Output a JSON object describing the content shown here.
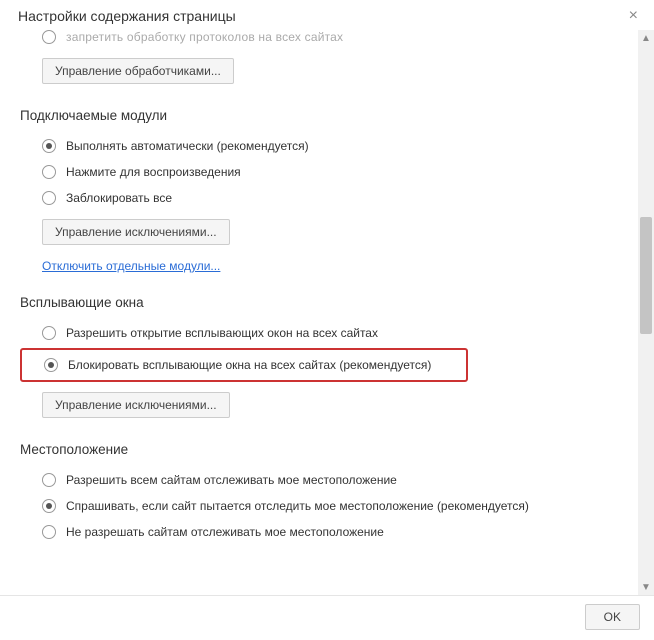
{
  "dialog": {
    "title": "Настройки содержания страницы",
    "ok": "OK"
  },
  "truncated_text": "запретить обработку протоколов на всех сайтах",
  "handlers": {
    "manage_button": "Управление обработчиками..."
  },
  "plugins": {
    "title": "Подключаемые модули",
    "options": [
      {
        "label": "Выполнять автоматически (рекомендуется)",
        "selected": true
      },
      {
        "label": "Нажмите для воспроизведения",
        "selected": false
      },
      {
        "label": "Заблокировать все",
        "selected": false
      }
    ],
    "manage_button": "Управление исключениями...",
    "disable_link": "Отключить отдельные модули..."
  },
  "popups": {
    "title": "Всплывающие окна",
    "options": [
      {
        "label": "Разрешить открытие всплывающих окон на всех сайтах",
        "selected": false
      },
      {
        "label": "Блокировать всплывающие окна на всех сайтах (рекомендуется)",
        "selected": true,
        "highlighted": true
      }
    ],
    "manage_button": "Управление исключениями..."
  },
  "location": {
    "title": "Местоположение",
    "options": [
      {
        "label": "Разрешить всем сайтам отслеживать мое местоположение",
        "selected": false
      },
      {
        "label": "Спрашивать, если сайт пытается отследить мое местоположение (рекомендуется)",
        "selected": true
      },
      {
        "label": "Не разрешать сайтам отслеживать мое местоположение",
        "selected": false
      }
    ]
  }
}
